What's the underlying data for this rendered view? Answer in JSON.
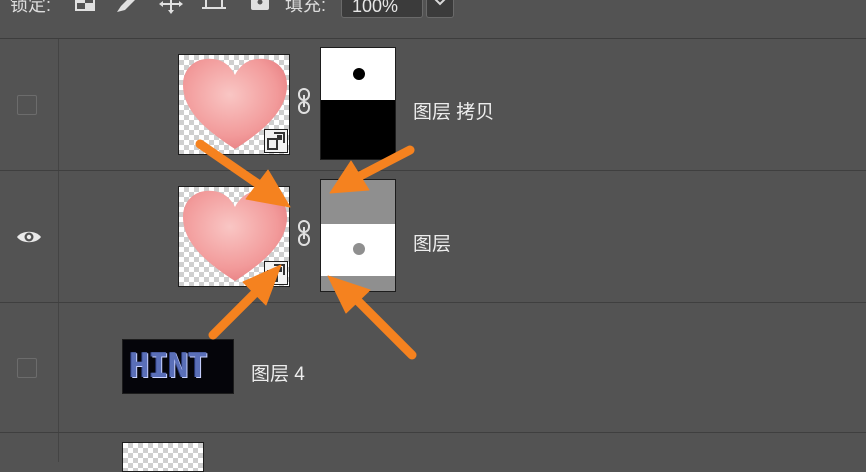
{
  "toolbar": {
    "lock_label": "锁定:",
    "fill_label": "填充:",
    "fill_value": "100%",
    "icons": [
      "lock-transparent-pixels-icon",
      "lock-image-pixels-icon",
      "lock-position-icon",
      "lock-artboard-icon",
      "lock-all-icon"
    ]
  },
  "layers": [
    {
      "name": "图层 拷贝",
      "visible": false,
      "has_mask": true,
      "smart_object": true
    },
    {
      "name": "图层",
      "visible": true,
      "has_mask": true,
      "smart_object": true
    },
    {
      "name": "图层 4",
      "visible": false,
      "has_mask": false,
      "smart_object": false,
      "thumb_text": "HINT"
    },
    {
      "name": "",
      "visible": false,
      "has_mask": false,
      "smart_object": false
    }
  ],
  "colors": {
    "panel_bg": "#535353",
    "arrow": "#f5821f",
    "heart": "#f4a6a6"
  }
}
